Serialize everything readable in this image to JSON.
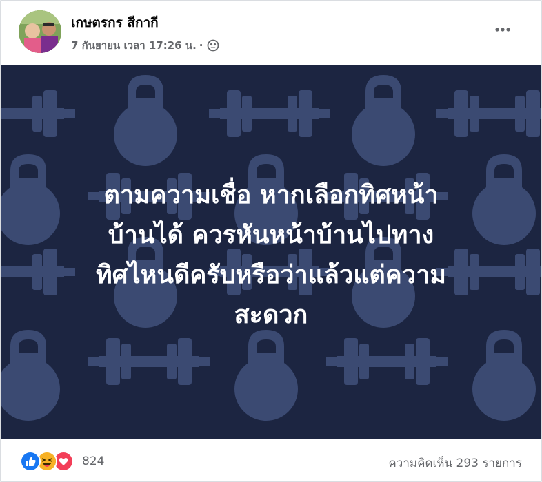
{
  "post": {
    "author": "เกษตรกร สีกากี",
    "timestamp": "7 กันยายน เวลา 17:26 น.",
    "separator": "·",
    "privacy_icon": "public-globe-icon",
    "more_icon": "more-options-icon",
    "banner_lines": [
      "ตามความเชื่อ หากเลือกทิศหน้า",
      "บ้านได้ ควรหันหน้าบ้านไปทาง",
      "ทิศไหนดีครับหรือว่าแล้วแต่ความ",
      "สะดวก"
    ],
    "banner_background": "#1c2541",
    "banner_pattern_color": "#3b4a72",
    "banner_pattern_icons": "kettlebell-and-dumbbell-icons"
  },
  "footer": {
    "reaction_icons": [
      "like-icon",
      "haha-icon",
      "love-icon"
    ],
    "reaction_count": "824",
    "comments_label": "ความคิดเห็น 293 รายการ"
  },
  "colors": {
    "like": "#1877f2",
    "haha": "#f7b125",
    "love": "#f33e58",
    "meta_text": "#65676b"
  }
}
